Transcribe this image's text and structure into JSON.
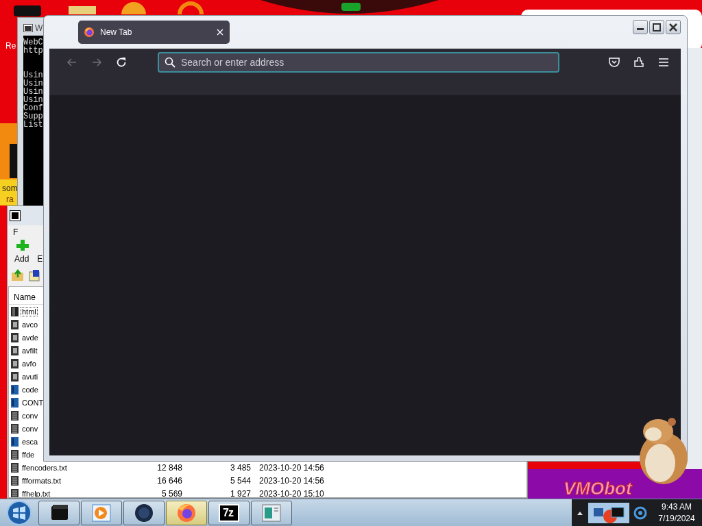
{
  "desktop": {
    "icon_labels": [
      "Re",
      "som",
      "ra"
    ]
  },
  "console_window": {
    "title": "W",
    "header_lines": [
      "WebC",
      "http"
    ],
    "log_lines": [
      "Usin",
      "Usin",
      "Usin",
      "Usin",
      "Conf",
      "Supp",
      "List"
    ]
  },
  "archive_window": {
    "menu": [
      "F"
    ],
    "toolbar": [
      "Add",
      "E"
    ],
    "columns": [
      "Name"
    ],
    "rows": [
      {
        "name": "html",
        "kind": "folder",
        "focused": true
      },
      {
        "name": "avco",
        "kind": "library",
        "focused": false
      },
      {
        "name": "avde",
        "kind": "library",
        "focused": false
      },
      {
        "name": "avfilt",
        "kind": "library",
        "focused": false
      },
      {
        "name": "avfo",
        "kind": "library",
        "focused": false
      },
      {
        "name": "avuti",
        "kind": "library",
        "focused": false
      },
      {
        "name": "code",
        "kind": "document",
        "focused": false
      },
      {
        "name": "CONT",
        "kind": "document",
        "focused": false
      },
      {
        "name": "conv",
        "kind": "text",
        "focused": false
      },
      {
        "name": "conv",
        "kind": "text",
        "focused": false
      },
      {
        "name": "esca",
        "kind": "document",
        "focused": false
      },
      {
        "name": "ffde",
        "kind": "text",
        "focused": false
      },
      {
        "name": "ffencoders.txt",
        "kind": "text",
        "focused": false,
        "cells": [
          "12 848",
          "3 485",
          "2023-10-20 14:56"
        ]
      },
      {
        "name": "ffformats.txt",
        "kind": "text",
        "focused": false,
        "cells": [
          "16 646",
          "5 544",
          "2023-10-20 14:56"
        ]
      },
      {
        "name": "ffhelp.txt",
        "kind": "text",
        "focused": false,
        "cells": [
          "5 569",
          "1 927",
          "2023-10-20 15:10"
        ]
      }
    ]
  },
  "browser": {
    "tabs": [
      {
        "label": "New Tab",
        "selected": true
      }
    ],
    "nav_buttons": [
      {
        "kind": "back",
        "disabled": true
      },
      {
        "kind": "forward",
        "disabled": true
      },
      {
        "kind": "reload",
        "disabled": false
      }
    ],
    "address_bar": {
      "placeholder": "Search or enter address"
    }
  },
  "banner": {
    "text": "VMObot"
  },
  "taskbar": {
    "buttons": [
      {
        "kind": "terminal",
        "selected": false
      },
      {
        "kind": "media",
        "selected": false
      },
      {
        "kind": "globe",
        "selected": false
      },
      {
        "kind": "firefox",
        "selected": true
      },
      {
        "kind": "archive",
        "selected": false,
        "label": "7z"
      },
      {
        "kind": "document",
        "selected": false
      }
    ],
    "clock": {
      "time": "9:43 AM",
      "date": "7/19/2024"
    }
  }
}
